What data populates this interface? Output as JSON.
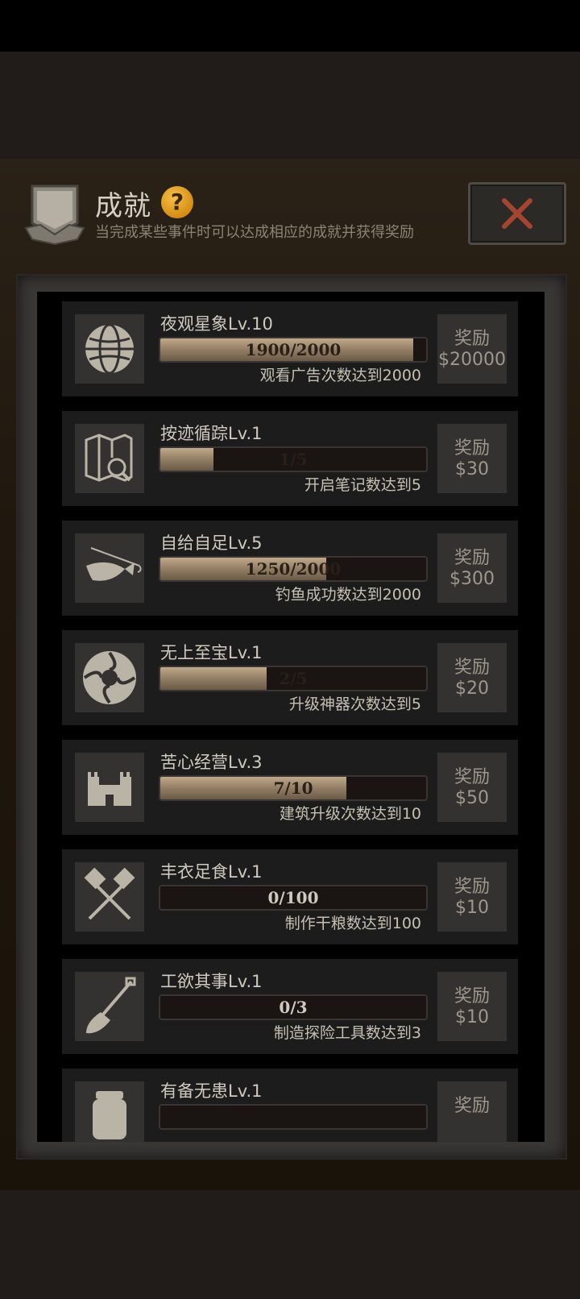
{
  "header": {
    "title": "成就",
    "help_glyph": "?",
    "subtitle": "当完成某些事件时可以达成相应的成就并获得奖励",
    "close_icon": "close-x-icon",
    "accent_color": "#a5452f"
  },
  "achievements": [
    {
      "name": "夜观星象Lv.10",
      "icon": "globe-icon",
      "progress": "1900/2000",
      "fraction": 0.95,
      "desc": "观看广告次数达到2000",
      "reward_label": "奖励",
      "reward_value": "$20000"
    },
    {
      "name": "按迹循踪Lv.1",
      "icon": "map-search-icon",
      "progress": "1/5",
      "fraction": 0.2,
      "desc": "开启笔记数达到5",
      "reward_label": "奖励",
      "reward_value": "$30"
    },
    {
      "name": "自给自足Lv.5",
      "icon": "fishing-icon",
      "progress": "1250/2000",
      "fraction": 0.625,
      "desc": "钓鱼成功数达到2000",
      "reward_label": "奖励",
      "reward_value": "$300"
    },
    {
      "name": "无上至宝Lv.1",
      "icon": "artifact-emblem-icon",
      "progress": "2/5",
      "fraction": 0.4,
      "desc": "升级神器次数达到5",
      "reward_label": "奖励",
      "reward_value": "$20"
    },
    {
      "name": "苦心经营Lv.3",
      "icon": "castle-icon",
      "progress": "7/10",
      "fraction": 0.7,
      "desc": "建筑升级次数达到10",
      "reward_label": "奖励",
      "reward_value": "$50"
    },
    {
      "name": "丰衣足食Lv.1",
      "icon": "crossed-spatulas-icon",
      "progress": "0/100",
      "fraction": 0,
      "desc": "制作干粮数达到100",
      "reward_label": "奖励",
      "reward_value": "$10"
    },
    {
      "name": "工欲其事Lv.1",
      "icon": "shovel-icon",
      "progress": "0/3",
      "fraction": 0,
      "desc": "制造探险工具数达到3",
      "reward_label": "奖励",
      "reward_value": "$10"
    },
    {
      "name": "有备无患Lv.1",
      "icon": "jar-icon",
      "progress": "",
      "fraction": 0,
      "desc": "",
      "reward_label": "奖励",
      "reward_value": ""
    }
  ]
}
